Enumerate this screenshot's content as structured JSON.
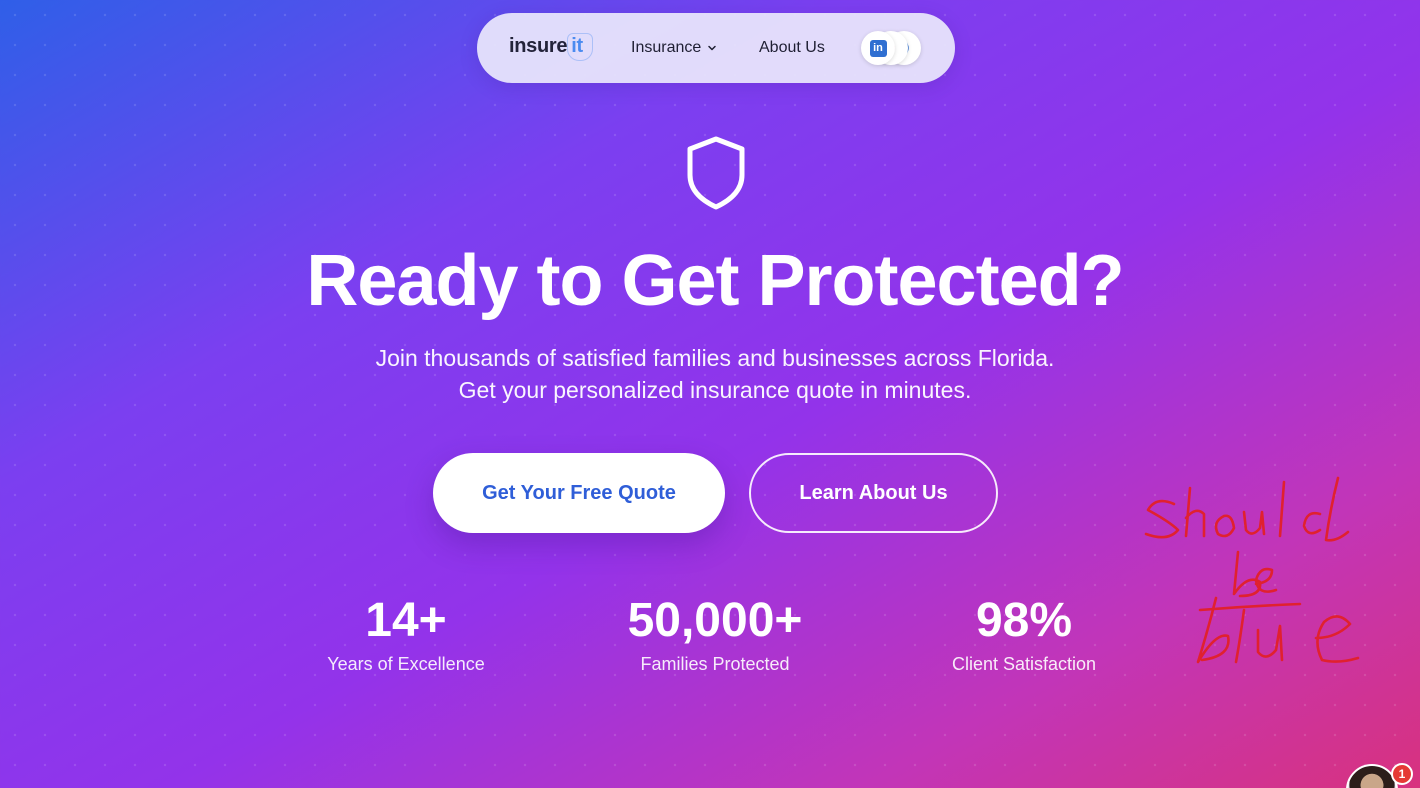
{
  "nav": {
    "logo_main": "insure",
    "logo_accent": "it",
    "insurance_label": "Insurance",
    "about_label": "About Us",
    "social_icons": [
      "linkedin-icon",
      "social-icon-2",
      "social-icon-3"
    ]
  },
  "hero": {
    "icon": "shield-icon",
    "title": "Ready to Get Protected?",
    "subtitle_line1": "Join thousands of satisfied families and businesses across Florida.",
    "subtitle_line2": "Get your personalized insurance quote in minutes.",
    "primary_button": "Get Your Free Quote",
    "secondary_button": "Learn About Us"
  },
  "stats": [
    {
      "value": "14+",
      "label": "Years of Excellence"
    },
    {
      "value": "50,000+",
      "label": "Families Protected"
    },
    {
      "value": "98%",
      "label": "Client Satisfaction"
    }
  ],
  "annotation": {
    "text": "should be blue",
    "color": "#e0212f"
  },
  "chat_widget": {
    "badge_count": "1"
  },
  "colors": {
    "primary_button_text": "#2f5ed8",
    "gradient_start": "#2f5fe8",
    "gradient_mid": "#9333ea",
    "gradient_end": "#d8327e"
  }
}
